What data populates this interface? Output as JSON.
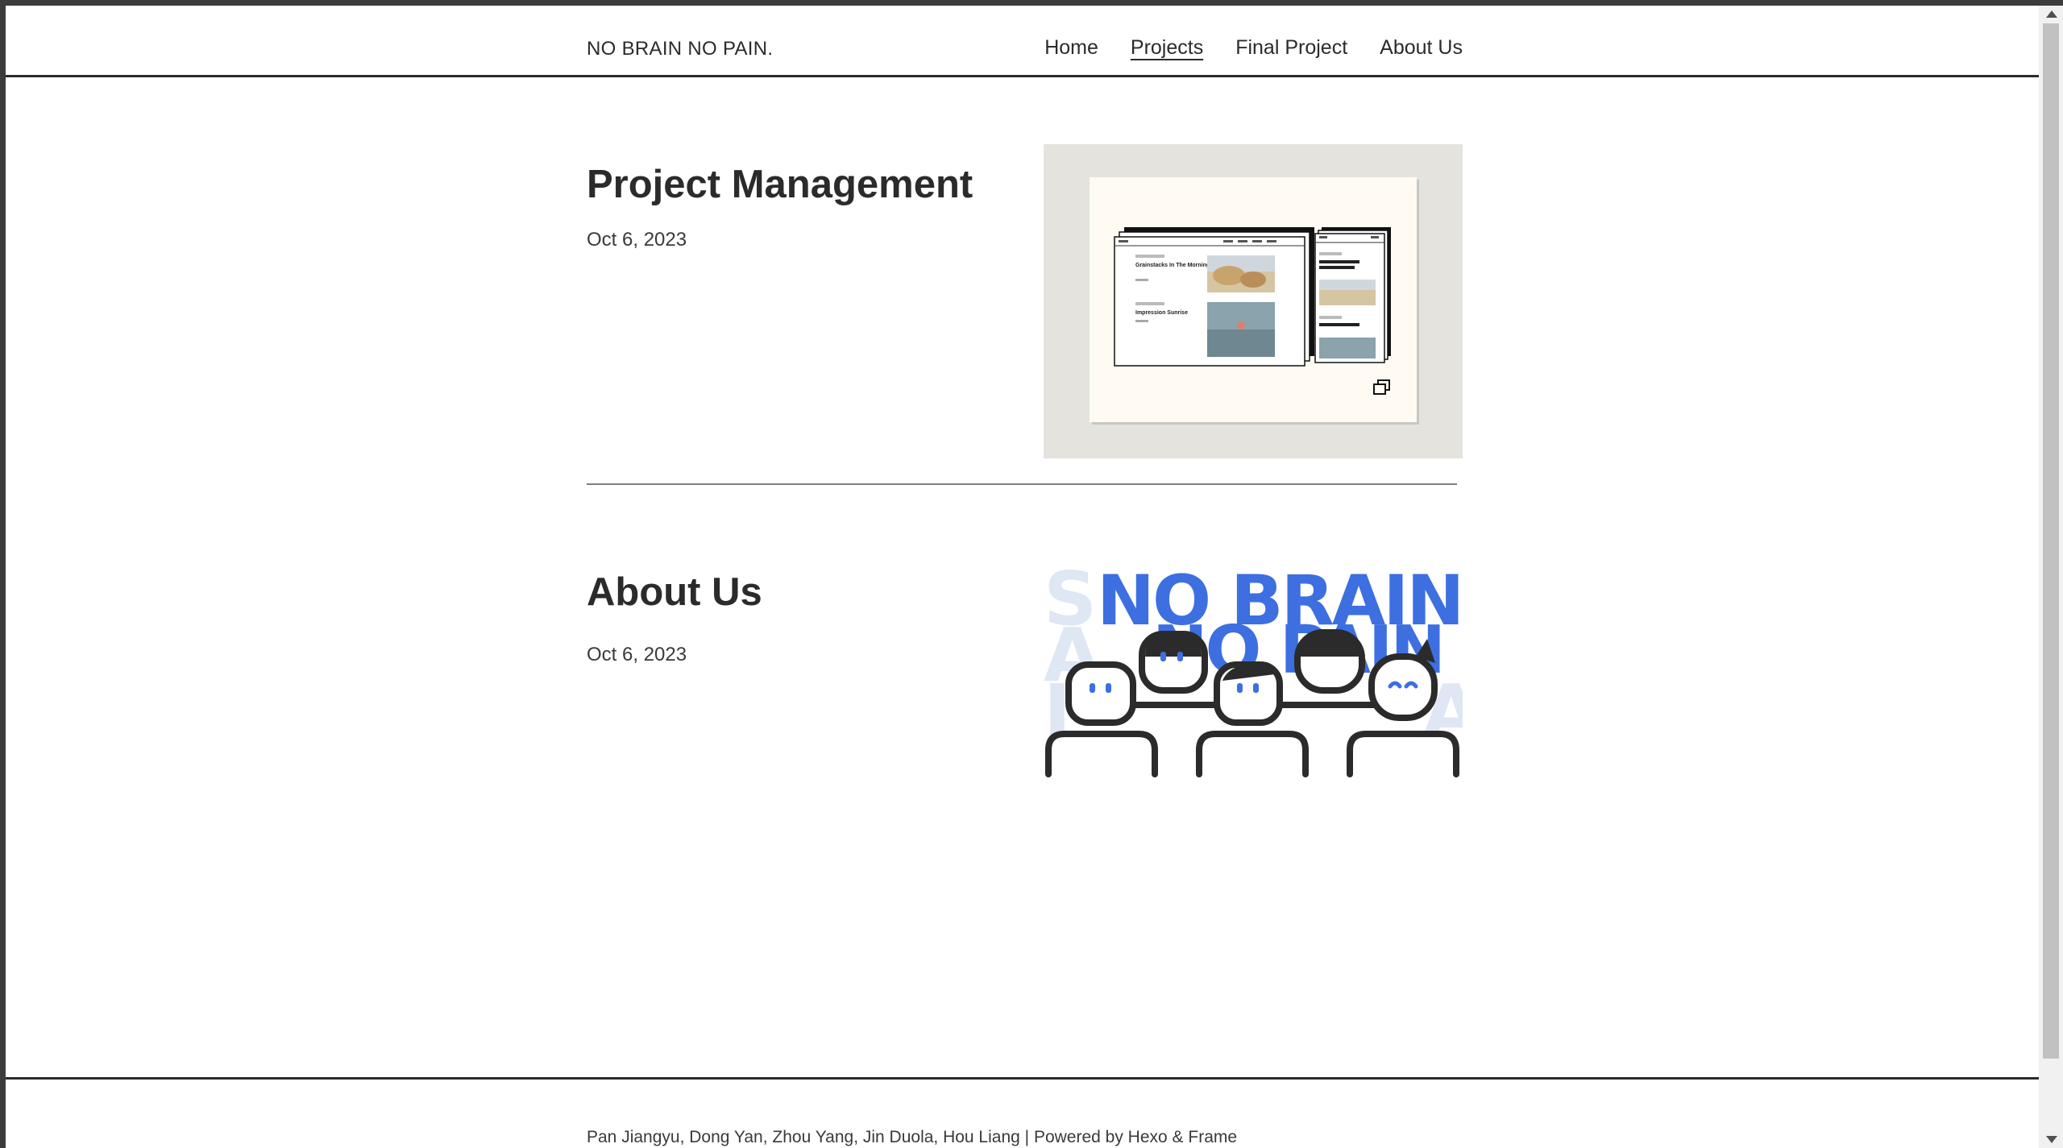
{
  "header": {
    "site_title": "NO BRAIN NO PAIN.",
    "nav": [
      {
        "label": "Home",
        "active": false
      },
      {
        "label": "Projects",
        "active": true
      },
      {
        "label": "Final Project",
        "active": false
      },
      {
        "label": "About Us",
        "active": false
      }
    ]
  },
  "posts": [
    {
      "title": "Project Management",
      "date": "Oct 6, 2023"
    },
    {
      "title": "About Us",
      "date": "Oct 6, 2023"
    }
  ],
  "thumbnail_mockup": {
    "post1_title": "Grainstacks In The Morning Effect",
    "post2_title": "Impression Sunrise"
  },
  "logo_text": {
    "line1": "NO BRAIN",
    "line2": "NO PAIN"
  },
  "footer": {
    "credits": "Pan Jiangyu, Dong Yan, Zhou Yang, Jin Duola, Hou Liang",
    "separator": " | ",
    "powered_by": "Powered by Hexo & Frame"
  },
  "colors": {
    "accent_blue": "#3d6fe0",
    "text": "#2b2b2b",
    "thumb_bg": "#e4e3de",
    "card_bg": "#fffbf2"
  }
}
